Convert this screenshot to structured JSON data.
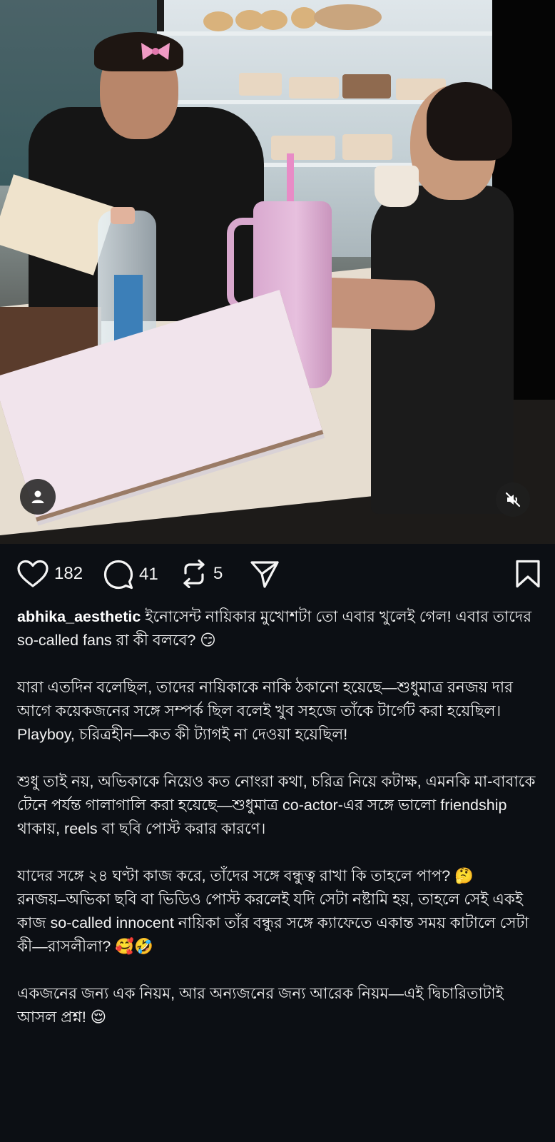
{
  "post": {
    "media_buttons": {
      "avatar_icon": "person-icon",
      "mute_icon": "speaker-muted-icon"
    },
    "actions": {
      "likes": "182",
      "comments": "41",
      "reposts": "5",
      "icons": {
        "like": "heart-icon",
        "comment": "comment-bubble-icon",
        "repost": "repost-icon",
        "share": "send-icon",
        "save": "bookmark-icon"
      }
    },
    "caption": {
      "username": "abhika_aesthetic",
      "paragraphs": [
        "ইনোসেন্ট নায়িকার মুখোশটা তো এবার খুলেই গেল! এবার তাদের so-called fans রা কী বলবে? 😏",
        "যারা এতদিন বলেছিল, তাদের নায়িকাকে নাকি ঠকানো হয়েছে—শুধুমাত্র রনজয় দার আগে কয়েকজনের সঙ্গে সম্পর্ক ছিল বলেই খুব সহজে তাঁকে টার্গেট করা হয়েছিল। Playboy, চরিত্রহীন—কত কী ট্যাগই না দেওয়া হয়েছিল!",
        "শুধু তাই নয়, অভিকাকে নিয়েও কত নোংরা কথা, চরিত্র নিয়ে কটাক্ষ, এমনকি মা-বাবাকে টেনে পর্যন্ত গালাগালি করা হয়েছে—শুধুমাত্র co-actor-এর সঙ্গে ভালো friendship থাকায়, reels বা ছবি পোস্ট করার কারণে।",
        "যাদের সঙ্গে ২৪ ঘণ্টা কাজ করে, তাঁদের সঙ্গে বন্ধুত্ব রাখা কি তাহলে পাপ? 🤔\nরনজয়–অভিকা ছবি বা ভিডিও পোস্ট করলেই যদি সেটা নষ্টামি হয়, তাহলে সেই একই কাজ so-called innocent নায়িকা তাঁর বন্ধুর সঙ্গে ক্যাফেতে একান্ত সময় কাটালে সেটা কী—রাসলীলা? 🥰🤣",
        "একজনের জন্য এক নিয়ম, আর অন্যজনের জন্য আরেক নিয়ম—এই দ্বিচারিতাটাই আসল প্রশ্ন! 😌"
      ]
    }
  }
}
